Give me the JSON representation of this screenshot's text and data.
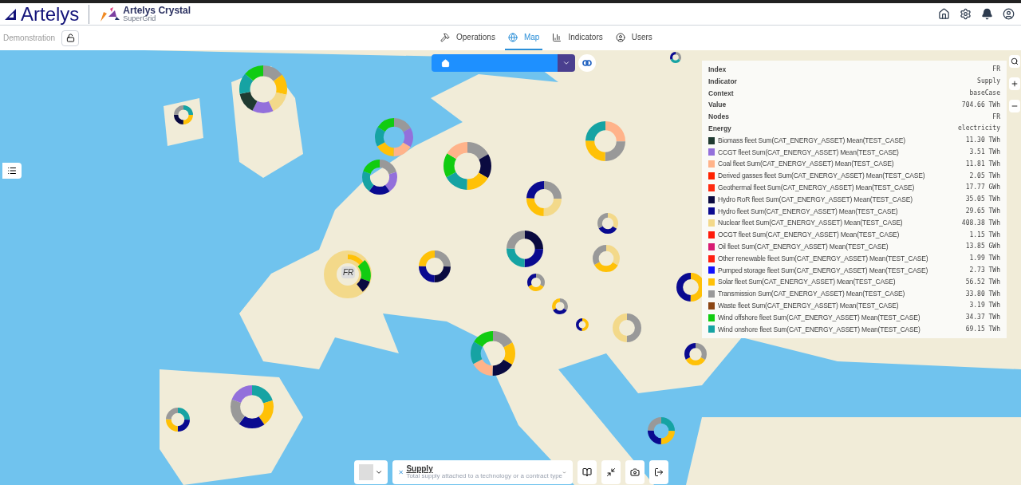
{
  "header": {
    "brand": "Artelys",
    "product": "Artelys Crystal",
    "product_sub": "SuperGrid"
  },
  "subbar": {
    "workspace": "Demonstration",
    "tabs": [
      {
        "label": "Operations",
        "selected": false
      },
      {
        "label": "Map",
        "selected": true
      },
      {
        "label": "Indicators",
        "selected": false
      },
      {
        "label": "Users",
        "selected": false
      }
    ]
  },
  "map": {
    "marker_label": "FR"
  },
  "info": {
    "fields": [
      {
        "label": "Index",
        "value": "FR"
      },
      {
        "label": "Indicator",
        "value": "Supply"
      },
      {
        "label": "Context",
        "value": "baseCase"
      },
      {
        "label": "Value",
        "value": "704.66 TWh"
      },
      {
        "label": "Nodes",
        "value": "FR"
      },
      {
        "label": "Energy",
        "value": "electricity"
      }
    ],
    "series": [
      {
        "name": "Biomass fleet Sum(CAT_ENERGY_ASSET) Mean(TEST_CASE)",
        "value": "11.30 TWh",
        "color": "#1f3a30"
      },
      {
        "name": "CCGT fleet Sum(CAT_ENERGY_ASSET) Mean(TEST_CASE)",
        "value": "3.51 TWh",
        "color": "#9370db"
      },
      {
        "name": "Coal fleet Sum(CAT_ENERGY_ASSET) Mean(TEST_CASE)",
        "value": "11.81 TWh",
        "color": "#ffb38a"
      },
      {
        "name": "Derived gasses fleet Sum(CAT_ENERGY_ASSET) Mean(TEST_CASE)",
        "value": "2.05 TWh",
        "color": "#ff2200"
      },
      {
        "name": "Geothermal fleet Sum(CAT_ENERGY_ASSET) Mean(TEST_CASE)",
        "value": "17.77 GWh",
        "color": "#ff2a10"
      },
      {
        "name": "Hydro RoR fleet Sum(CAT_ENERGY_ASSET) Mean(TEST_CASE)",
        "value": "35.05 TWh",
        "color": "#0a0a40"
      },
      {
        "name": "Hydro fleet Sum(CAT_ENERGY_ASSET) Mean(TEST_CASE)",
        "value": "29.65 TWh",
        "color": "#0a0a90"
      },
      {
        "name": "Nuclear fleet Sum(CAT_ENERGY_ASSET) Mean(TEST_CASE)",
        "value": "408.38 TWh",
        "color": "#f3d98a"
      },
      {
        "name": "OCGT fleet Sum(CAT_ENERGY_ASSET) Mean(TEST_CASE)",
        "value": "1.15 TWh",
        "color": "#ff1a0a"
      },
      {
        "name": "Oil fleet Sum(CAT_ENERGY_ASSET) Mean(TEST_CASE)",
        "value": "13.85 GWh",
        "color": "#d81b72"
      },
      {
        "name": "Other renewable fleet Sum(CAT_ENERGY_ASSET) Mean(TEST_CASE)",
        "value": "1.99 TWh",
        "color": "#ff2010"
      },
      {
        "name": "Pumped storage fleet Sum(CAT_ENERGY_ASSET) Mean(TEST_CASE)",
        "value": "2.73 TWh",
        "color": "#1010ff"
      },
      {
        "name": "Solar fleet Sum(CAT_ENERGY_ASSET) Mean(TEST_CASE)",
        "value": "56.52 TWh",
        "color": "#ffc107"
      },
      {
        "name": "Transmission Sum(CAT_ENERGY_ASSET) Mean(TEST_CASE)",
        "value": "33.80 TWh",
        "color": "#999999"
      },
      {
        "name": "Waste fleet Sum(CAT_ENERGY_ASSET) Mean(TEST_CASE)",
        "value": "3.19 TWh",
        "color": "#8b4513"
      },
      {
        "name": "Wind offshore fleet Sum(CAT_ENERGY_ASSET) Mean(TEST_CASE)",
        "value": "34.37 TWh",
        "color": "#11cc11"
      },
      {
        "name": "Wind onshore fleet Sum(CAT_ENERGY_ASSET) Mean(TEST_CASE)",
        "value": "69.15 TWh",
        "color": "#16a3a3"
      }
    ]
  },
  "indicator": {
    "title": "Supply",
    "description": "Total supply attached to a technology or a contract type"
  }
}
